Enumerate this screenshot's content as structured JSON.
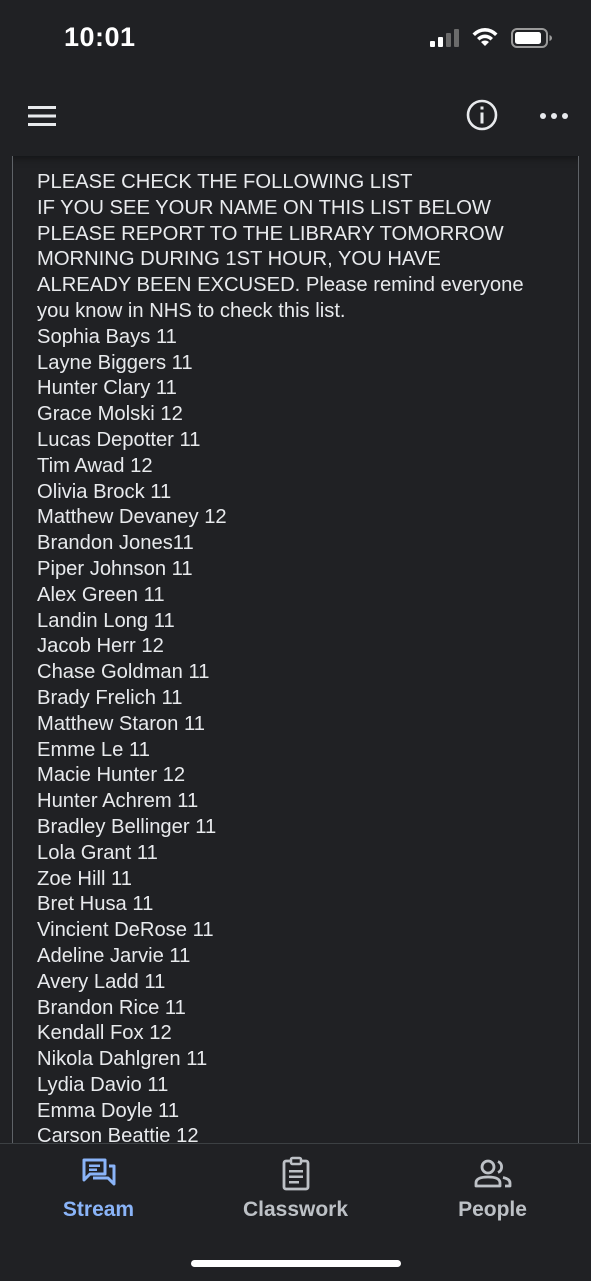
{
  "status_bar": {
    "time": "10:01",
    "icons": [
      "cellular-signal-icon",
      "wifi-icon",
      "battery-icon"
    ]
  },
  "app_bar": {
    "icons": [
      "menu-icon",
      "info-icon",
      "more-options-icon"
    ]
  },
  "post": {
    "intro_lines": [
      "PLEASE CHECK THE FOLLOWING LIST",
      "IF YOU SEE YOUR NAME ON THIS LIST BELOW",
      "PLEASE REPORT TO THE LIBRARY TOMORROW",
      "MORNING DURING 1ST HOUR, YOU HAVE",
      "ALREADY BEEN EXCUSED. Please remind everyone",
      "you know in NHS to check this list."
    ],
    "names": [
      "Sophia Bays 11",
      "Layne Biggers 11",
      "Hunter Clary 11",
      "Grace Molski 12",
      "Lucas Depotter 11",
      "Tim Awad 12",
      "Olivia Brock 11",
      "Matthew Devaney 12",
      "Brandon Jones11",
      "Piper Johnson 11",
      "Alex Green 11",
      "Landin Long 11",
      "Jacob Herr 12",
      "Chase Goldman 11",
      "Brady Frelich 11",
      "Matthew Staron 11",
      "Emme Le 11",
      "Macie Hunter 12",
      "Hunter Achrem 11",
      "Bradley Bellinger 11",
      "Lola Grant 11",
      "Zoe Hill 11",
      "Bret Husa 11",
      "Vincient DeRose 11",
      "Adeline Jarvie 11",
      "Avery Ladd 11",
      "Brandon Rice 11",
      "Kendall Fox 12",
      "Nikola Dahlgren 11",
      "Lydia Davio 11",
      "Emma Doyle 11",
      "Carson Beattie 12"
    ]
  },
  "bottom_nav": {
    "items": [
      {
        "label": "Stream",
        "icon": "stream-icon",
        "active": true
      },
      {
        "label": "Classwork",
        "icon": "classwork-icon",
        "active": false
      },
      {
        "label": "People",
        "icon": "people-icon",
        "active": false
      }
    ]
  },
  "colors": {
    "background": "#202124",
    "text": "#e8eaed",
    "active_tab": "#8ab4f8",
    "inactive_tab": "#bdc1c6"
  }
}
